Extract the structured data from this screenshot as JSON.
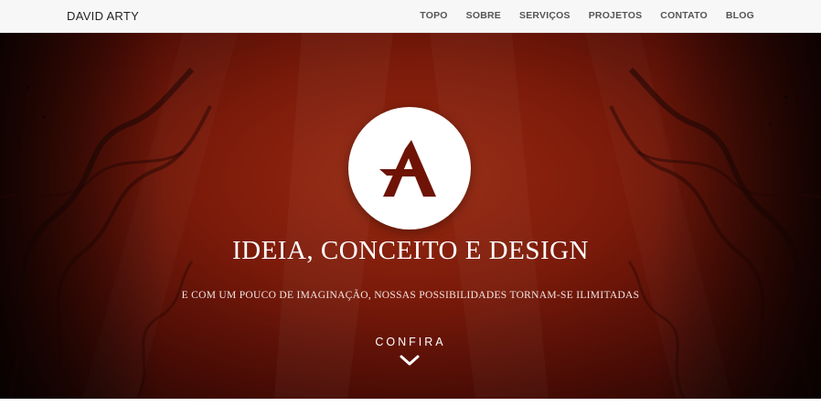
{
  "navbar": {
    "brand": "DAVID ARTY",
    "items": [
      {
        "label": "TOPO"
      },
      {
        "label": "SOBRE"
      },
      {
        "label": "SERVIÇOS"
      },
      {
        "label": "PROJETOS"
      },
      {
        "label": "CONTATO"
      },
      {
        "label": "BLOG"
      }
    ]
  },
  "hero": {
    "headline": "IDEIA, CONCEITO E DESIGN",
    "subline": "E COM UM POUCO DE IMAGINAÇÃO, NOSSAS POSSIBILIDADES TORNAM-SE ILIMITADAS",
    "cta_label": "CONFIRA",
    "cta_icon": "chevron-down-icon",
    "logo_icon": "logo-a-icon"
  },
  "colors": {
    "hero_dark": "#1c0503",
    "hero_mid": "#7a1a0a",
    "hero_light": "#9a2a10",
    "logo_mark": "#6e1306",
    "navbar_bg": "#f7f7f7"
  }
}
